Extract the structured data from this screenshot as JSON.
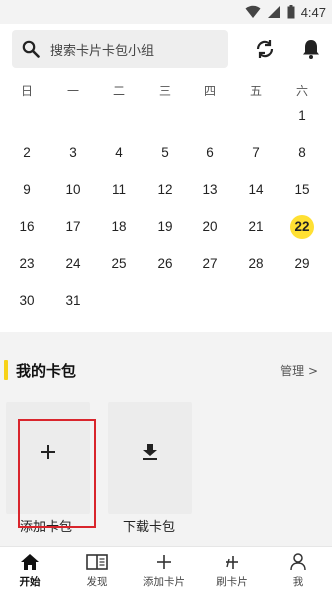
{
  "status_bar": {
    "time": "4:47"
  },
  "search": {
    "placeholder": "搜索卡片卡包小组"
  },
  "calendar": {
    "weekdays": [
      "日",
      "一",
      "二",
      "三",
      "四",
      "五",
      "六"
    ],
    "rows": [
      [
        "",
        "",
        "",
        "",
        "",
        "",
        "1"
      ],
      [
        "2",
        "3",
        "4",
        "5",
        "6",
        "7",
        "8"
      ],
      [
        "9",
        "10",
        "11",
        "12",
        "13",
        "14",
        "15"
      ],
      [
        "16",
        "17",
        "18",
        "19",
        "20",
        "21",
        "22"
      ],
      [
        "23",
        "24",
        "25",
        "26",
        "27",
        "28",
        "29"
      ],
      [
        "30",
        "31",
        "",
        "",
        "",
        "",
        ""
      ]
    ],
    "today": "22",
    "highlight_color": "#ffe033"
  },
  "my_packs": {
    "title": "我的卡包",
    "manage_label": "管理 >",
    "accent_color": "#f7d21a",
    "tiles": [
      {
        "label": "添加卡包",
        "icon": "plus-icon"
      },
      {
        "label": "下载卡包",
        "icon": "download-icon"
      }
    ]
  },
  "bottom_nav": {
    "items": [
      {
        "label": "开始",
        "icon": "home-icon",
        "active": true
      },
      {
        "label": "发现",
        "icon": "book-icon",
        "active": false
      },
      {
        "label": "添加卡片",
        "icon": "plus-icon",
        "active": false
      },
      {
        "label": "刷卡片",
        "icon": "swipe-icon",
        "active": false
      },
      {
        "label": "我",
        "icon": "person-icon",
        "active": false
      }
    ]
  }
}
